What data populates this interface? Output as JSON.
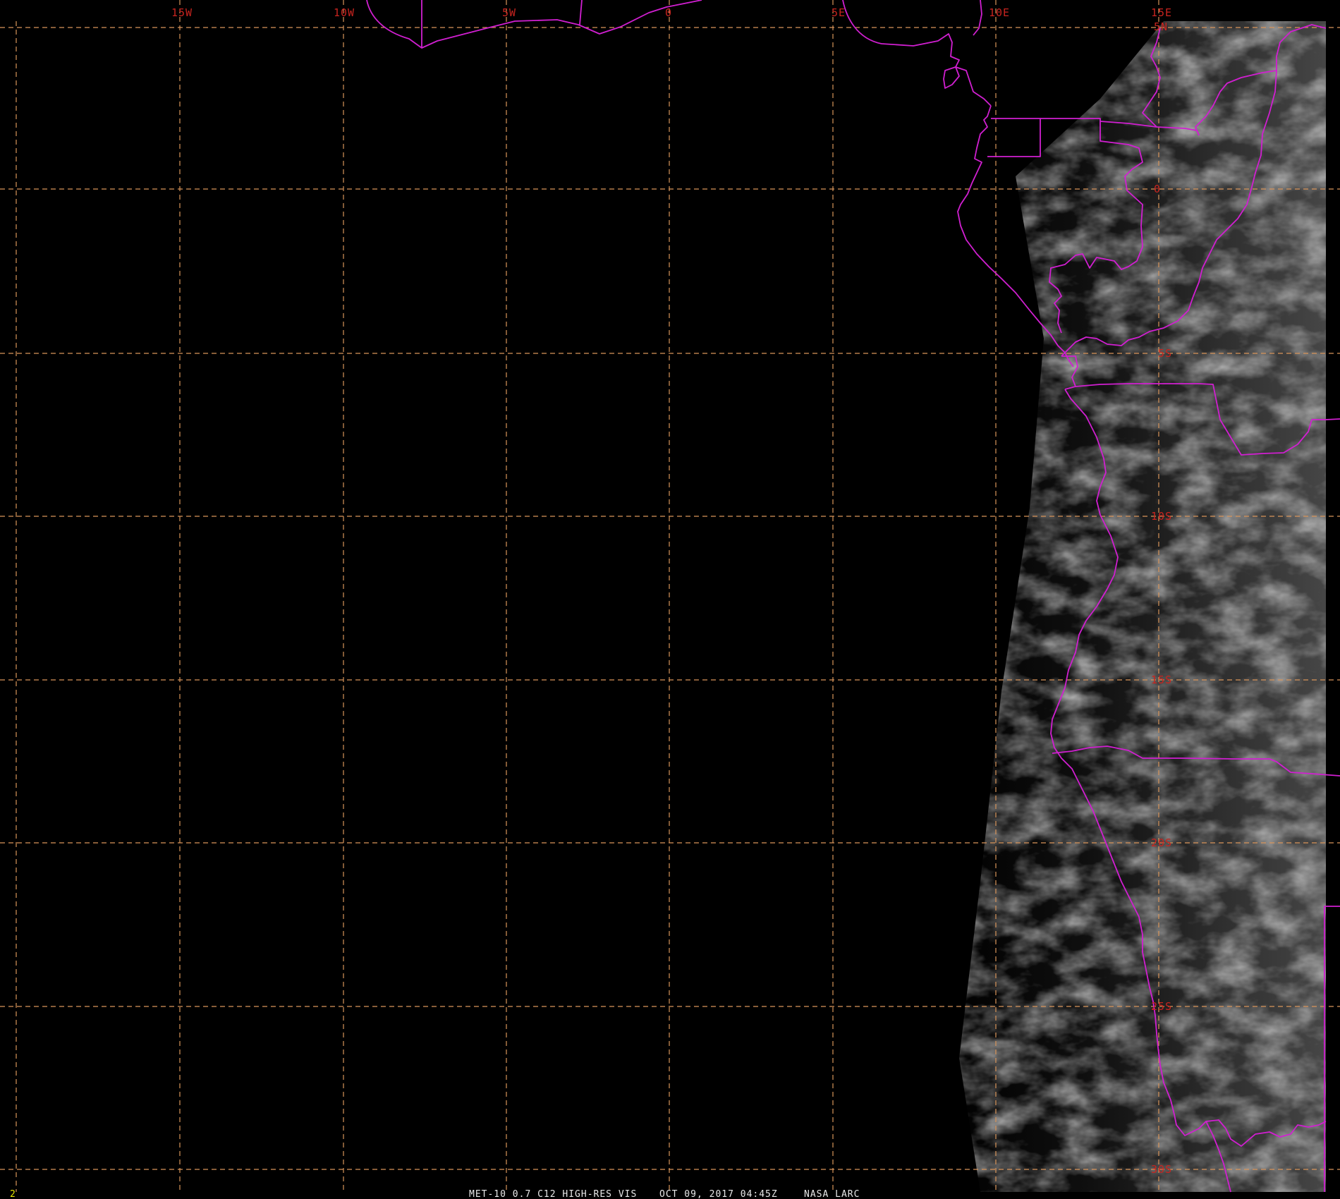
{
  "map": {
    "caption": {
      "satellite": "MET-10 0.7 C12 HIGH-RES VIS",
      "datetime": "OCT 09, 2017 04:45Z",
      "source": "NASA LARC"
    },
    "frame_number": "2",
    "longitude_labels": [
      "15W",
      "10W",
      "5W",
      "0",
      "5E",
      "10E",
      "15E"
    ],
    "latitude_labels": [
      "5N",
      "0",
      "5S",
      "10S",
      "15S",
      "20S",
      "25S",
      "30S"
    ],
    "colors": {
      "background": "#000000",
      "grid": "#d9955a",
      "boundaries": "#d11fd1",
      "labels": "#c8241f",
      "caption": "#e8e8e8",
      "frame_number": "#e6e600"
    }
  }
}
